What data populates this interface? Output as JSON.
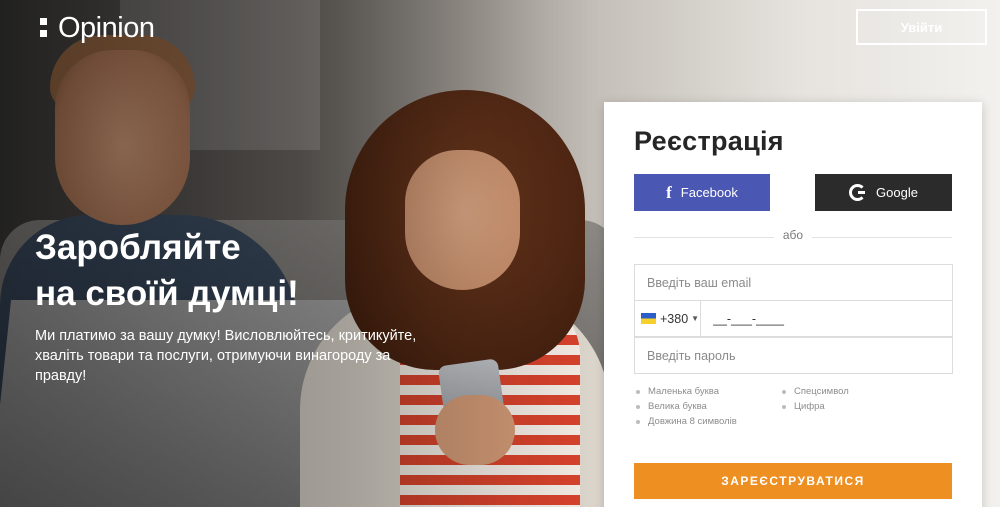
{
  "header": {
    "logo_text": "Opinion",
    "login_label": "Увійти"
  },
  "hero": {
    "headline_line1": "Заробляйте",
    "headline_line2": "на своїй думці!",
    "subtext_line1": "Ми платимо за вашу думку! Висловлюйтесь, критикуйте,",
    "subtext_line2": "хваліть товари та послуги, отримуючи винагороду за правду!"
  },
  "registration": {
    "title": "Реєстрація",
    "facebook_label": "Facebook",
    "google_label": "Google",
    "divider_label": "або",
    "email_placeholder": "Введіть ваш email",
    "country_code": "+380",
    "phone_value": "__-___-____",
    "password_placeholder": "Введіть пароль",
    "rules_left": [
      "Маленька буква",
      "Велика буква",
      "Довжина 8 символів"
    ],
    "rules_right": [
      "Спецсимвол",
      "Цифра"
    ],
    "submit_label": "ЗАРЕЄСТРУВАТИСЯ"
  },
  "colors": {
    "facebook": "#4a58b4",
    "google": "#2b2b2b",
    "submit": "#ee8f22"
  },
  "icons": [
    "facebook-icon",
    "google-icon",
    "ukraine-flag-icon",
    "caret-down-icon"
  ]
}
